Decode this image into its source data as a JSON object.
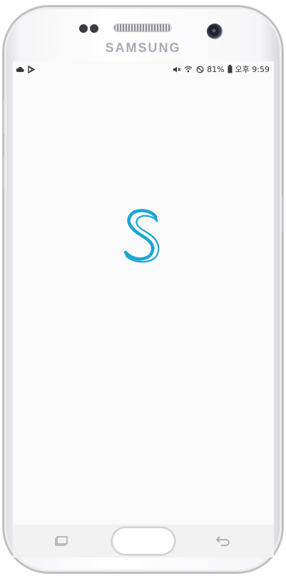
{
  "device": {
    "brand": "SAMSUNG"
  },
  "status_bar": {
    "left_icons": [
      "cloud-icon",
      "play-store-icon"
    ],
    "right_icons": [
      "mute-icon",
      "wifi-icon",
      "do-not-disturb-icon",
      "battery-icon"
    ],
    "battery_percent": "81%",
    "time": "오후 9:59"
  },
  "app": {
    "logo_icon": "s-letter-logo-icon",
    "accent_color": "#1aa6d4"
  },
  "navigation": {
    "recent_icon": "recent-apps-icon",
    "home_icon": "home-button",
    "back_icon": "back-icon"
  }
}
